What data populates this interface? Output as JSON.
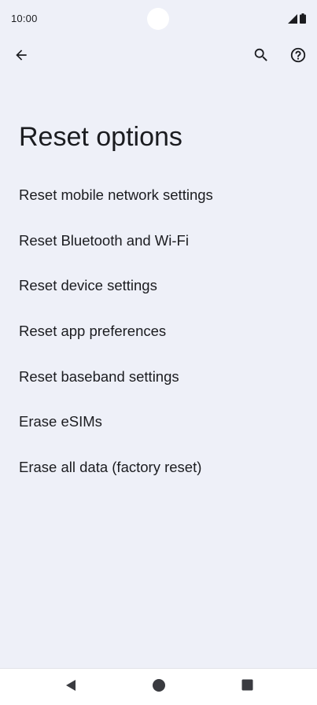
{
  "status_bar": {
    "time": "10:00",
    "signal_icon": "signal-icon",
    "battery_icon": "battery-icon"
  },
  "toolbar": {
    "back_icon": "arrow-back-icon",
    "search_icon": "search-icon",
    "help_icon": "help-icon"
  },
  "page": {
    "title": "Reset options"
  },
  "options": [
    {
      "label": "Reset mobile network settings"
    },
    {
      "label": "Reset Bluetooth and Wi-Fi"
    },
    {
      "label": "Reset device settings"
    },
    {
      "label": "Reset app preferences"
    },
    {
      "label": "Reset baseband settings"
    },
    {
      "label": "Erase eSIMs"
    },
    {
      "label": "Erase all data (factory reset)"
    }
  ],
  "nav_bar": {
    "back_icon": "nav-back-triangle-icon",
    "home_icon": "nav-home-circle-icon",
    "recents_icon": "nav-recents-square-icon"
  },
  "colors": {
    "background": "#eef0f8",
    "text": "#1b1c20",
    "nav_background": "#ffffff"
  }
}
